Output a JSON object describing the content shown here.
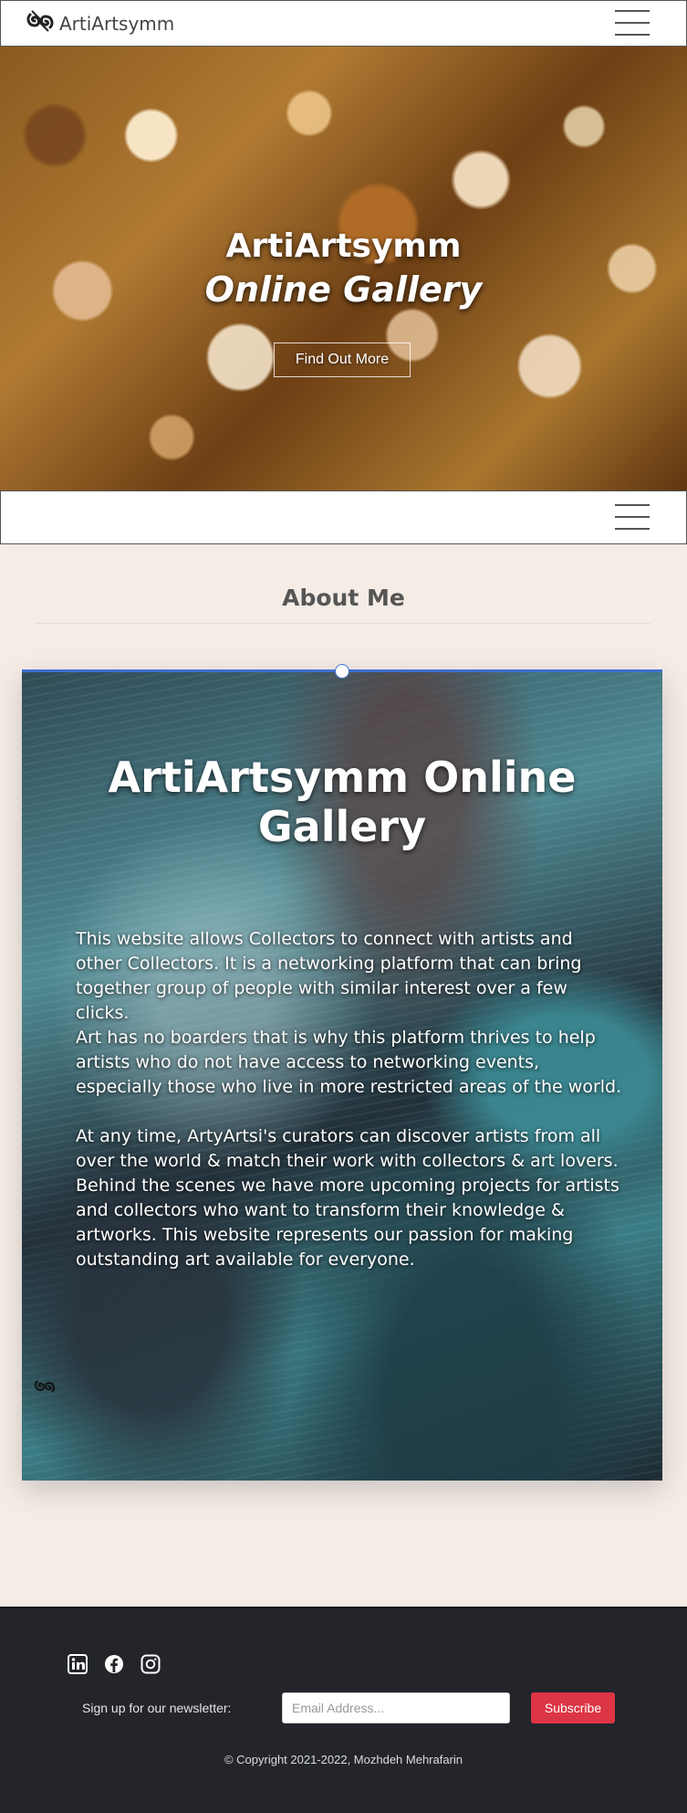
{
  "nav": {
    "brand": "ArtiArtsymm",
    "toggle_icon": "hamburger-icon"
  },
  "hero": {
    "line1": "ArtiArtsymm",
    "line2": "Online Gallery",
    "button": "Find Out More"
  },
  "about": {
    "heading": "About Me",
    "card_title": "ArtiArtsymm Online Gallery",
    "paragraphs": [
      "This website allows Collectors to connect with artists and other Collectors. It is a networking platform that can bring together group of people with similar interest over a few clicks.",
      "Art has no boarders that is why this platform thrives to help artists who do not have access to networking events, especially those who live in more restricted areas of the world.",
      "At any time, ArtyArtsi's curators can discover artists from all over the world & match their work with collectors & art lovers. Behind the scenes we have more upcoming projects for artists and collectors who want to transform their knowledge & artworks. This website represents our passion for making outstanding art available for everyone."
    ]
  },
  "footer": {
    "social_icons": [
      "linkedin-icon",
      "facebook-icon",
      "instagram-icon"
    ],
    "newsletter_label": "Sign up for our newsletter:",
    "email_placeholder": "Email Address...",
    "subscribe": "Subscribe",
    "copyright": "© Copyright 2021-2022, Mozhdeh Mehrafarin"
  },
  "colors": {
    "accent": "#dc3545",
    "footer_bg": "#23252b",
    "page_bg": "#f5ece6",
    "card_border": "#3b6fd1"
  }
}
